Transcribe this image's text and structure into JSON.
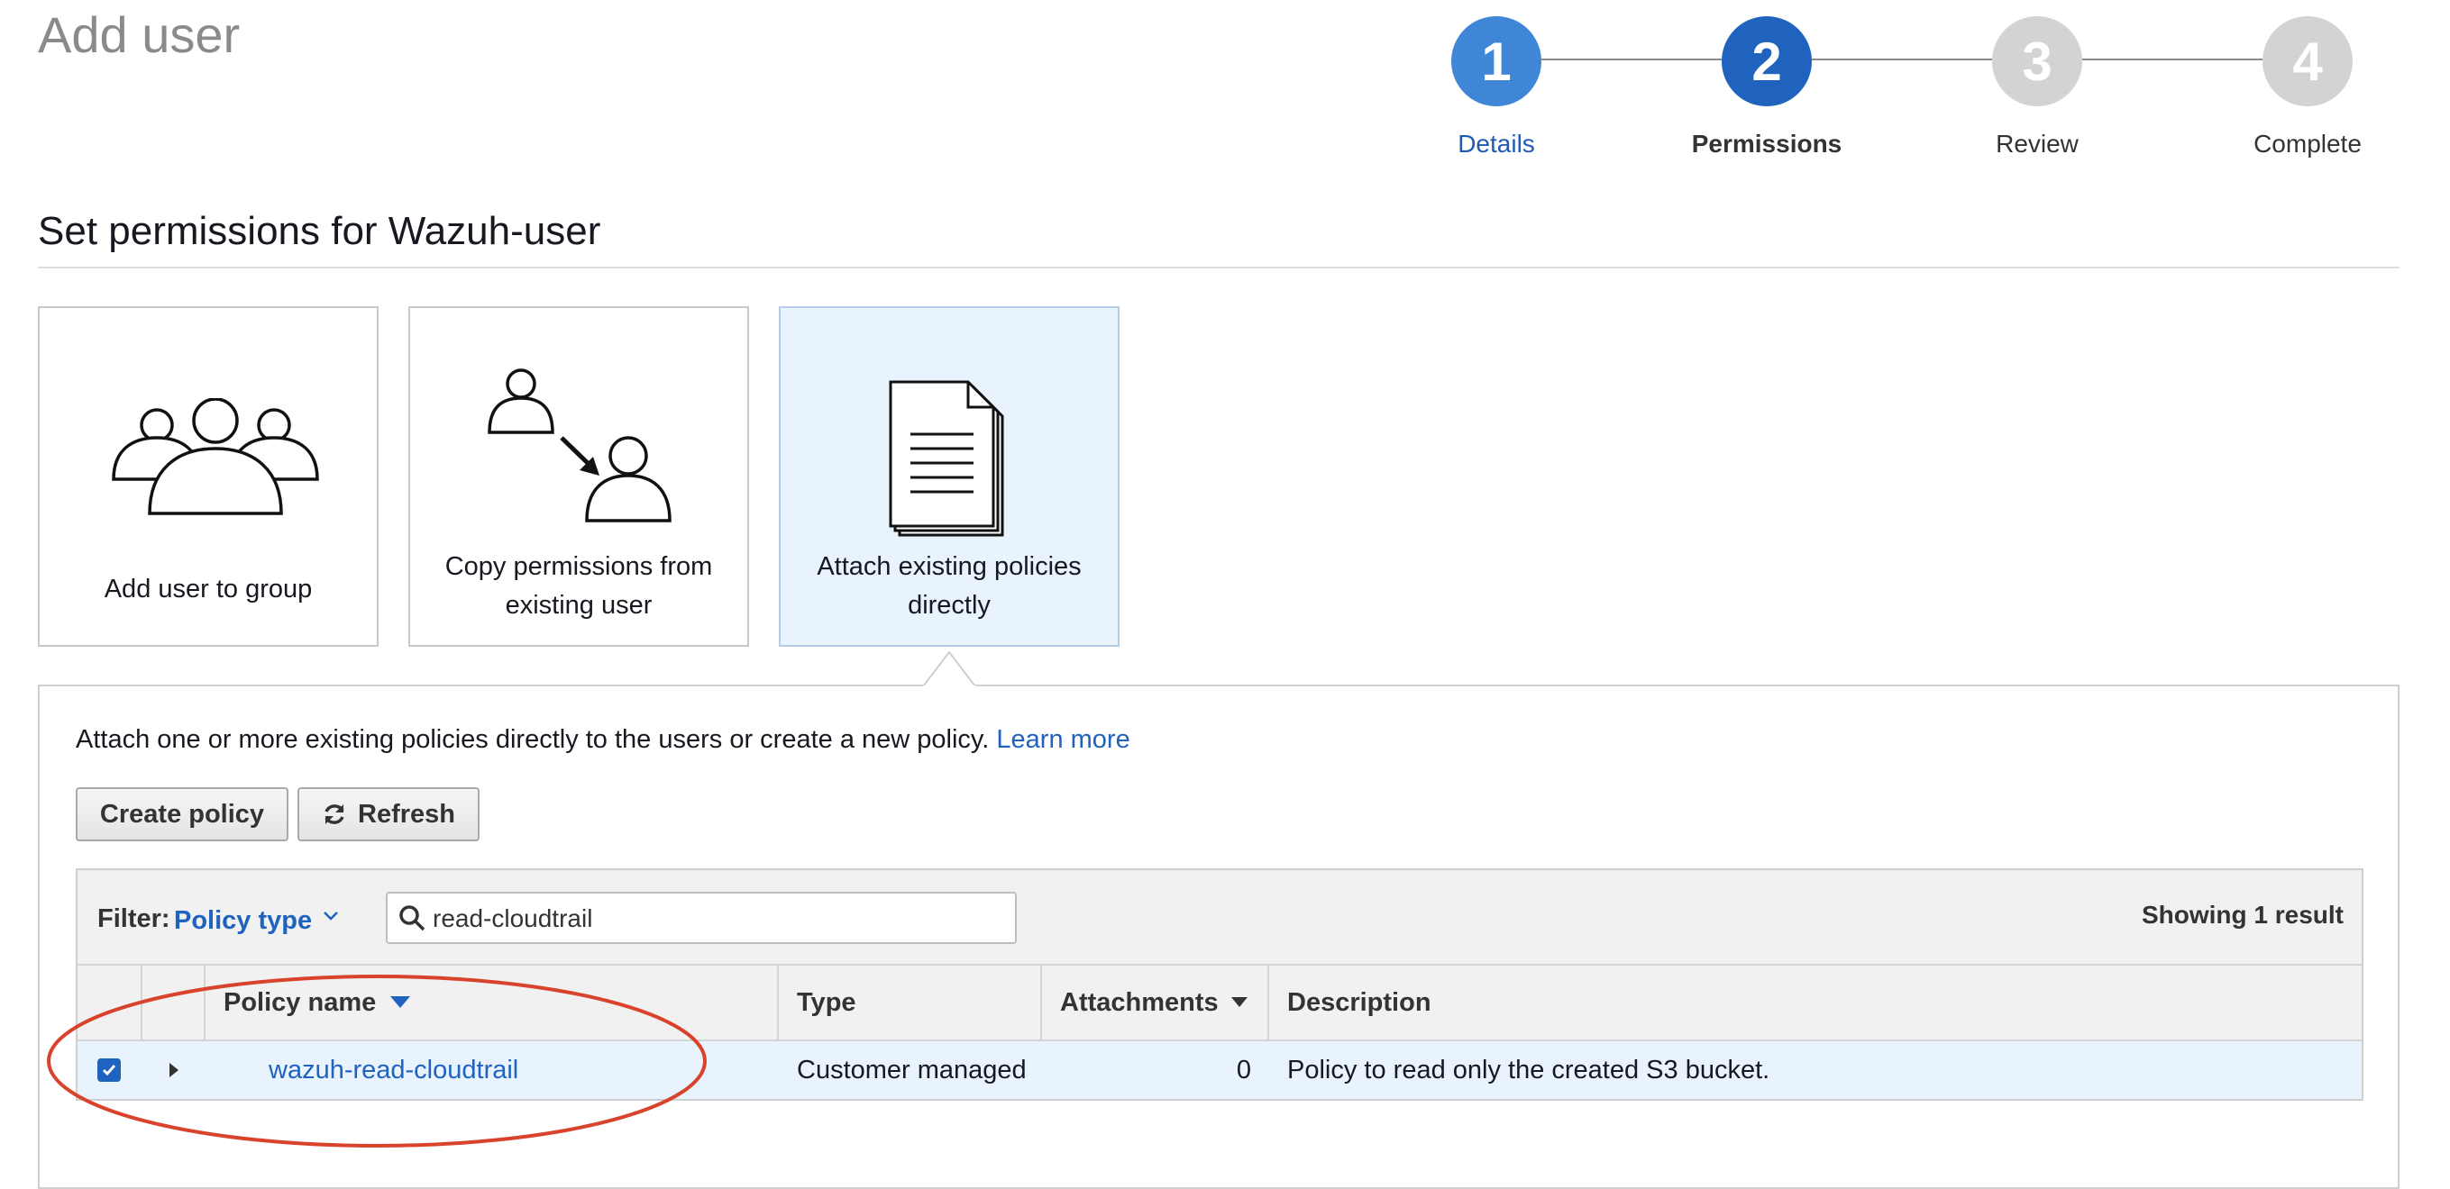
{
  "page": {
    "title": "Add user"
  },
  "stepper": {
    "steps": [
      {
        "number": "1",
        "label": "Details",
        "state": "done"
      },
      {
        "number": "2",
        "label": "Permissions",
        "state": "active"
      },
      {
        "number": "3",
        "label": "Review",
        "state": "todo"
      },
      {
        "number": "4",
        "label": "Complete",
        "state": "todo"
      }
    ]
  },
  "section": {
    "title": "Set permissions for Wazuh-user"
  },
  "options": [
    {
      "label": "Add user to group",
      "icon": "group-icon",
      "selected": false
    },
    {
      "label": "Copy permissions from existing user",
      "icon": "copy-user-icon",
      "selected": false
    },
    {
      "label": "Attach existing policies directly",
      "icon": "document-icon",
      "selected": true
    }
  ],
  "panel": {
    "description": "Attach one or more existing policies directly to the users or create a new policy.",
    "learn_more": "Learn more",
    "create_policy_label": "Create policy",
    "refresh_label": "Refresh"
  },
  "filter": {
    "label": "Filter:",
    "type_link": "Policy type",
    "search_value": "read-cloudtrail",
    "showing": "Showing 1 result"
  },
  "table": {
    "columns": [
      "Policy name",
      "Type",
      "Attachments",
      "Description"
    ],
    "rows": [
      {
        "checked": true,
        "name": "wazuh-read-cloudtrail",
        "type": "Customer managed",
        "attachments": "0",
        "description": "Policy to read only the created S3 bucket."
      }
    ]
  },
  "colors": {
    "accent": "#1f63bf",
    "selected_bg": "#e8f3fd",
    "annotation": "#d9432c"
  }
}
